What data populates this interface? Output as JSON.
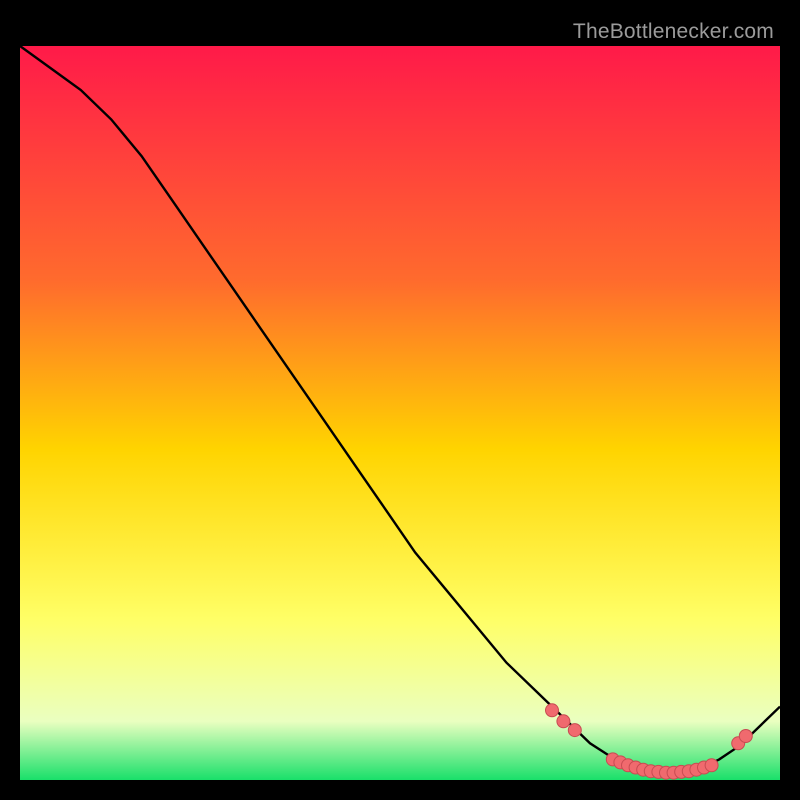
{
  "watermark": "TheBottlenecker.com",
  "colors": {
    "grad_top": "#ff1a49",
    "grad_mid1": "#ff6b2d",
    "grad_mid2": "#ffd400",
    "grad_low1": "#ffff66",
    "grad_low2": "#eaffc0",
    "grad_bottom": "#19e06a",
    "curve": "#000000",
    "dot_fill": "#f06a6e",
    "dot_stroke": "#c84b52"
  },
  "chart_data": {
    "type": "line",
    "title": "",
    "xlabel": "",
    "ylabel": "",
    "xlim": [
      0,
      100
    ],
    "ylim": [
      0,
      100
    ],
    "series": [
      {
        "name": "bottleneck-curve",
        "x": [
          0,
          4,
          8,
          12,
          16,
          20,
          24,
          28,
          32,
          36,
          40,
          44,
          48,
          52,
          56,
          60,
          64,
          68,
          72,
          75,
          78,
          80,
          82,
          84,
          86,
          88,
          90,
          92,
          94,
          96,
          98,
          100
        ],
        "y": [
          100,
          97,
          94,
          90,
          85,
          79,
          73,
          67,
          61,
          55,
          49,
          43,
          37,
          31,
          26,
          21,
          16,
          12,
          8,
          5,
          3,
          2,
          1.3,
          1,
          1,
          1.2,
          1.8,
          2.8,
          4.2,
          6,
          8,
          10
        ]
      }
    ],
    "dots": {
      "name": "highlight-dots",
      "x": [
        70,
        71.5,
        73,
        78,
        79,
        80,
        81,
        82,
        83,
        84,
        85,
        86,
        87,
        88,
        89,
        90,
        91,
        94.5,
        95.5
      ],
      "y": [
        9.5,
        8,
        6.8,
        2.8,
        2.4,
        2,
        1.7,
        1.4,
        1.2,
        1.1,
        1,
        1,
        1.1,
        1.2,
        1.4,
        1.7,
        2,
        5,
        6
      ]
    }
  }
}
